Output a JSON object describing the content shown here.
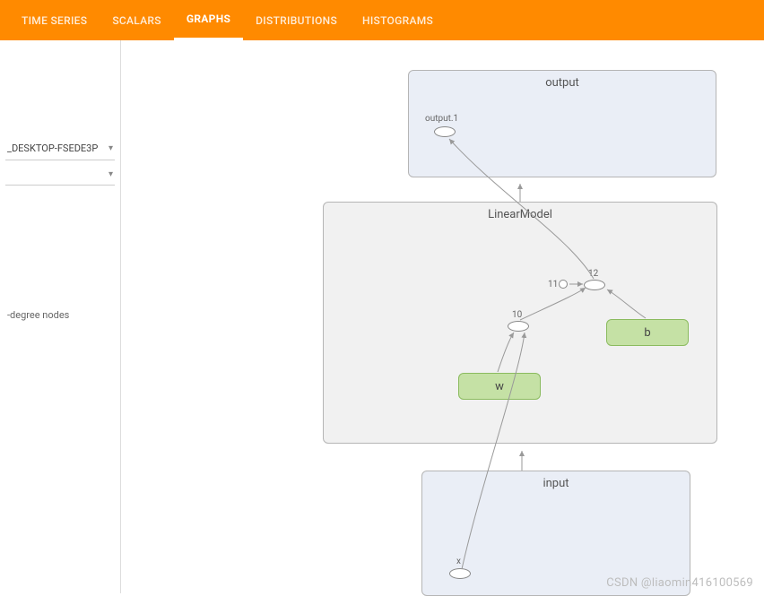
{
  "tabs": {
    "time_series": "TIME SERIES",
    "scalars": "SCALARS",
    "graphs": "GRAPHS",
    "distributions": "DISTRIBUTIONS",
    "histograms": "HISTOGRAMS"
  },
  "sidebar": {
    "run_label": "_DESKTOP-FSEDE3P",
    "degree_nodes": "-degree nodes"
  },
  "graph": {
    "output": {
      "title": "output",
      "sub": "output.1"
    },
    "linear": {
      "title": "LinearModel",
      "n10": "10",
      "n11": "11",
      "n12": "12",
      "w": "w",
      "b": "b"
    },
    "input": {
      "title": "input",
      "x": "x"
    }
  },
  "watermark": "CSDN @liaomin416100569"
}
